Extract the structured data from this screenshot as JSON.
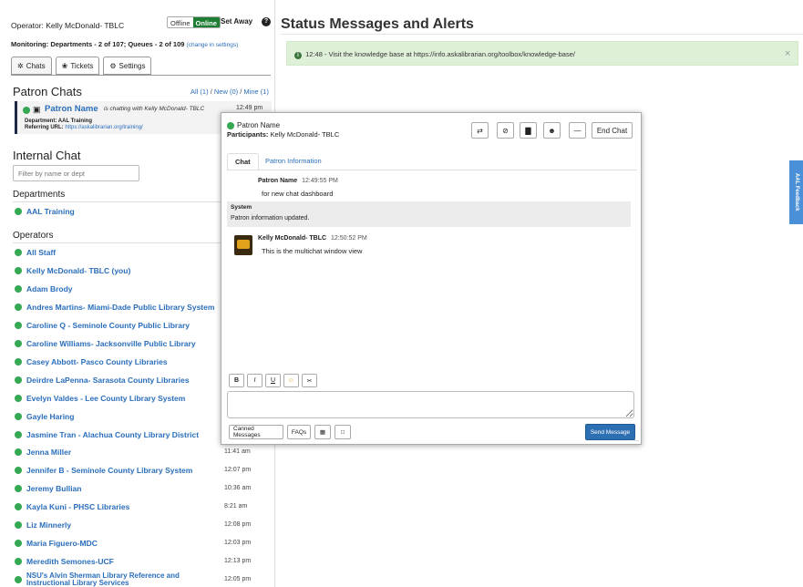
{
  "operator": {
    "label": "Operator: Kelly McDonald- TBLC",
    "offline": "Offline",
    "online": "Online",
    "set_away": "Set Away",
    "help_icon": "question-circle-icon"
  },
  "monitoring": {
    "text": "Monitoring: Departments - 2 of 107; Queues - 2 of 109",
    "link": "(change in settings)"
  },
  "tabs": [
    {
      "icon": "✲",
      "label": "Chats"
    },
    {
      "icon": "❀",
      "label": "Tickets"
    },
    {
      "icon": "⚙",
      "label": "Settings"
    }
  ],
  "patron_chats": {
    "title": "Patron Chats",
    "filter_all": "All (1)",
    "filter_new": "New (0)",
    "filter_mine": "Mine (1)",
    "chat": {
      "name": "Patron Name",
      "status": "is chatting with Kelly McDonald- TBLC",
      "time": "12:49 pm",
      "department": "Department: AAL Training",
      "referring_label": "Referring URL:",
      "referring_url": "https://askalibrarian.org/training/"
    }
  },
  "internal_chat": {
    "title": "Internal Chat",
    "filter_placeholder": "Filter by name or dept",
    "departments_title": "Departments",
    "departments": [
      "AAL Training"
    ],
    "operators_title": "Operators",
    "operators": [
      {
        "name": "All Staff",
        "time": ""
      },
      {
        "name": "Kelly McDonald- TBLC (you)",
        "time": ""
      },
      {
        "name": "Adam Brody",
        "time": ""
      },
      {
        "name": "Andres Martins- Miami-Dade Public Library System",
        "time": ""
      },
      {
        "name": "Caroline Q - Seminole County Public Library",
        "time": ""
      },
      {
        "name": "Caroline Williams- Jacksonville Public Library",
        "time": ""
      },
      {
        "name": "Casey Abbott- Pasco County Libraries",
        "time": ""
      },
      {
        "name": "Deirdre LaPenna- Sarasota County Libraries",
        "time": ""
      },
      {
        "name": "Evelyn Valdes - Lee County Library System",
        "time": ""
      },
      {
        "name": "Gayle Haring",
        "time": ""
      },
      {
        "name": "Jasmine Tran - Alachua County Library District",
        "time": ""
      },
      {
        "name": "Jenna Miller",
        "time": "11:41 am"
      },
      {
        "name": "Jennifer B - Seminole County Library System",
        "time": "12:07 pm"
      },
      {
        "name": "Jeremy Bullian",
        "time": "10:36 am"
      },
      {
        "name": "Kayla Kuni - PHSC Libraries",
        "time": "8:21 am"
      },
      {
        "name": "Liz Minnerly",
        "time": "12:08 pm"
      },
      {
        "name": "Maria Figuero-MDC",
        "time": "12:03 pm"
      },
      {
        "name": "Meredith Semones-UCF",
        "time": "12:13 pm"
      },
      {
        "name": "NSU's Alvin Sherman Library Reference and Instructional Library Services",
        "time": "12:05 pm"
      }
    ]
  },
  "main": {
    "title": "Status Messages and Alerts",
    "alert_text": "12:48 - Visit the knowledge base at https://info.askalibrarian.org/toolbox/knowledge-base/",
    "alert_close": "×",
    "side_tab": "AAL Feedback"
  },
  "chat_window": {
    "patron_name": "Patron Name",
    "participants_label": "Participants:",
    "participants": "Kelly McDonald- TBLC",
    "toolbar_icons": [
      "transfer-icon",
      "block-icon",
      "chart-icon",
      "users-icon",
      "minimize-icon"
    ],
    "toolbar_glyphs": [
      "⇄",
      "⊘",
      "▇",
      "☻",
      "—"
    ],
    "end_chat": "End Chat",
    "tab_chat": "Chat",
    "tab_patron_info": "Patron Information",
    "messages": [
      {
        "author": "Patron Name",
        "time": "12:49:55 PM",
        "text": "for new chat dashboard"
      },
      {
        "author": "Kelly McDonald- TBLC",
        "time": "12:50:52 PM",
        "text": "This is the multichat window view"
      }
    ],
    "system_label": "System",
    "system_text": "Patron information updated.",
    "format_buttons": [
      "B",
      "I",
      "U",
      "☺",
      "✂"
    ],
    "canned_messages": "Canned Messages",
    "faqs": "FAQs",
    "send_message": "Send Message"
  }
}
